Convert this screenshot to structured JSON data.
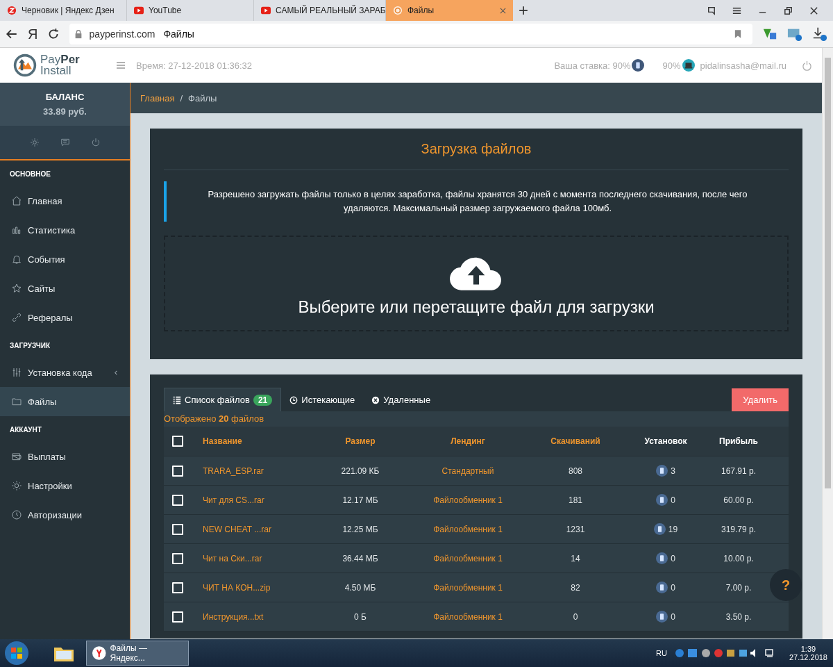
{
  "browser": {
    "tabs": [
      {
        "title": "Черновик | Яндекс Дзен",
        "kind": "zen",
        "selected": false
      },
      {
        "title": "YouTube",
        "kind": "youtube",
        "selected": false
      },
      {
        "title": "САМЫЙ РЕАЛЬНЫЙ ЗАРАБ",
        "kind": "youtube",
        "selected": false
      },
      {
        "title": "Файлы",
        "kind": "site",
        "selected": true
      }
    ],
    "new_tab": "+",
    "home_glyph": "Я",
    "domain": "payperinst.com",
    "page_title": "Файлы"
  },
  "header": {
    "logo": {
      "pay": "Pay",
      "per": "Per",
      "install": "Install"
    },
    "time": "Время: 27-12-2018 01:36:32",
    "rate": "Ваша ставка: 90%",
    "rate2": "90%",
    "email": "pidalinsasha@mail.ru"
  },
  "sidebar": {
    "balance_label": "БАЛАНС",
    "balance": "33.89 руб.",
    "sections": [
      {
        "title": "ОСНОВНОЕ",
        "items": [
          {
            "label": "Главная",
            "kind": "home",
            "selected": false,
            "caret": false
          },
          {
            "label": "Статистика",
            "kind": "chart",
            "selected": false,
            "caret": false
          },
          {
            "label": "События",
            "kind": "bell",
            "selected": false,
            "caret": false
          },
          {
            "label": "Сайты",
            "kind": "star",
            "selected": false,
            "caret": false
          },
          {
            "label": "Рефералы",
            "kind": "link",
            "selected": false,
            "caret": false
          }
        ]
      },
      {
        "title": "ЗАГРУЗЧИК",
        "items": [
          {
            "label": "Установка кода",
            "kind": "sliders",
            "selected": false,
            "caret": true
          },
          {
            "label": "Файлы",
            "kind": "folder",
            "selected": true,
            "caret": false
          }
        ]
      },
      {
        "title": "АККАУНТ",
        "items": [
          {
            "label": "Выплаты",
            "kind": "wallet",
            "selected": false,
            "caret": false
          },
          {
            "label": "Настройки",
            "kind": "gear",
            "selected": false,
            "caret": false
          },
          {
            "label": "Авторизации",
            "kind": "clock",
            "selected": false,
            "caret": false
          }
        ]
      }
    ]
  },
  "breadcrumb": {
    "items": [
      "Главная",
      "Файлы"
    ],
    "separator": "/"
  },
  "upload": {
    "title": "Загрузка файлов",
    "notice": "Разрешено загружать файлы только в целях заработка, файлы хранятся 30 дней с момента последнего скачивания, после чего удаляются. Максимальный размер загружаемого файла 100мб.",
    "drop_text": "Выберите или перетащите файл для загрузки"
  },
  "files": {
    "tabs": [
      {
        "label": "Список файлов",
        "kind": "list",
        "badge": "21",
        "selected": true
      },
      {
        "label": "Истекающие",
        "kind": "clock",
        "selected": false
      },
      {
        "label": "Удаленные",
        "kind": "x",
        "selected": false
      }
    ],
    "delete_button": "Удалить",
    "shown": "Отображено **20** файлов",
    "select_all_checked": false,
    "columns": [
      {
        "label": "Название",
        "sortable": true
      },
      {
        "label": "Размер",
        "sortable": true
      },
      {
        "label": "Лендинг",
        "sortable": true
      },
      {
        "label": "Скачиваний",
        "sortable": true
      },
      {
        "label": "Установок",
        "sortable": false
      },
      {
        "label": "Прибыль",
        "sortable": false
      }
    ],
    "rows": [
      {
        "checked": false,
        "name": "TRARA_ESP.rar",
        "size": "221.09 КБ",
        "landing": "Стандартный",
        "downloads": "808",
        "installs": "3",
        "profit": "167.91 р."
      },
      {
        "checked": false,
        "name": "Чит для CS...rar",
        "size": "12.17 МБ",
        "landing": "Файлообменник 1",
        "downloads": "181",
        "installs": "0",
        "profit": "60.00 р."
      },
      {
        "checked": false,
        "name": "NEW CHEAT ...rar",
        "size": "12.25 МБ",
        "landing": "Файлообменник 1",
        "downloads": "1231",
        "installs": "19",
        "profit": "319.79 р."
      },
      {
        "checked": false,
        "name": "Чит на Ски...rar",
        "size": "36.44 МБ",
        "landing": "Файлообменник 1",
        "downloads": "14",
        "installs": "0",
        "profit": "10.00 р."
      },
      {
        "checked": false,
        "name": "ЧИТ НА КОН...zip",
        "size": "4.50 МБ",
        "landing": "Файлообменник 1",
        "downloads": "82",
        "installs": "0",
        "profit": "7.00 р."
      },
      {
        "checked": false,
        "name": "Инструкция...txt",
        "size": "0 Б",
        "landing": "Файлообменник 1",
        "downloads": "0",
        "installs": "0",
        "profit": "3.50 р."
      }
    ]
  },
  "help_button": "?",
  "taskbar": {
    "window": "Файлы — Яндекс...",
    "lang": "RU",
    "time": "1:39",
    "date": "27.12.2018"
  }
}
